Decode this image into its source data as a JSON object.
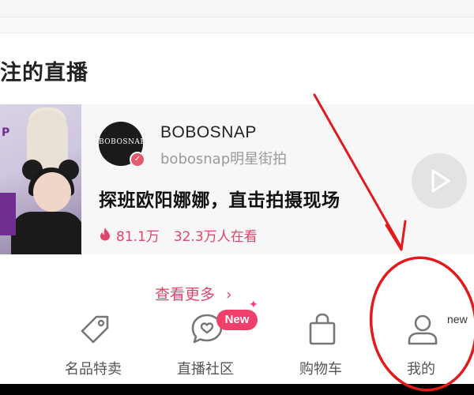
{
  "section": {
    "title": "注的直播"
  },
  "live_card": {
    "thumb_logo": "P",
    "avatar_text": "BOBOSNAP",
    "verified_icon": "v-badge-icon",
    "streamer_name": "BOBOSNAP",
    "streamer_handle": "bobosnap明星街拍",
    "title": "探班欧阳娜娜，直击拍摄现场",
    "likes": "81.1万",
    "viewers": "32.3万人在看",
    "flame_icon": "flame-icon",
    "play_icon": "play-icon"
  },
  "see_more": {
    "label": "查看更多",
    "chevron": "›"
  },
  "bottom_nav": {
    "items": [
      {
        "label": "名品特卖",
        "icon": "tag-icon"
      },
      {
        "label": "直播社区",
        "icon": "heart-chat-icon",
        "badge": "New"
      },
      {
        "label": "购物车",
        "icon": "shopping-bag-icon"
      },
      {
        "label": "我的",
        "icon": "user-icon",
        "badge": "new"
      }
    ]
  },
  "colors": {
    "accent": "#e0456b",
    "annotation": "#e11b1b",
    "text_dark": "#222222",
    "text_muted": "#9a9a9a"
  }
}
